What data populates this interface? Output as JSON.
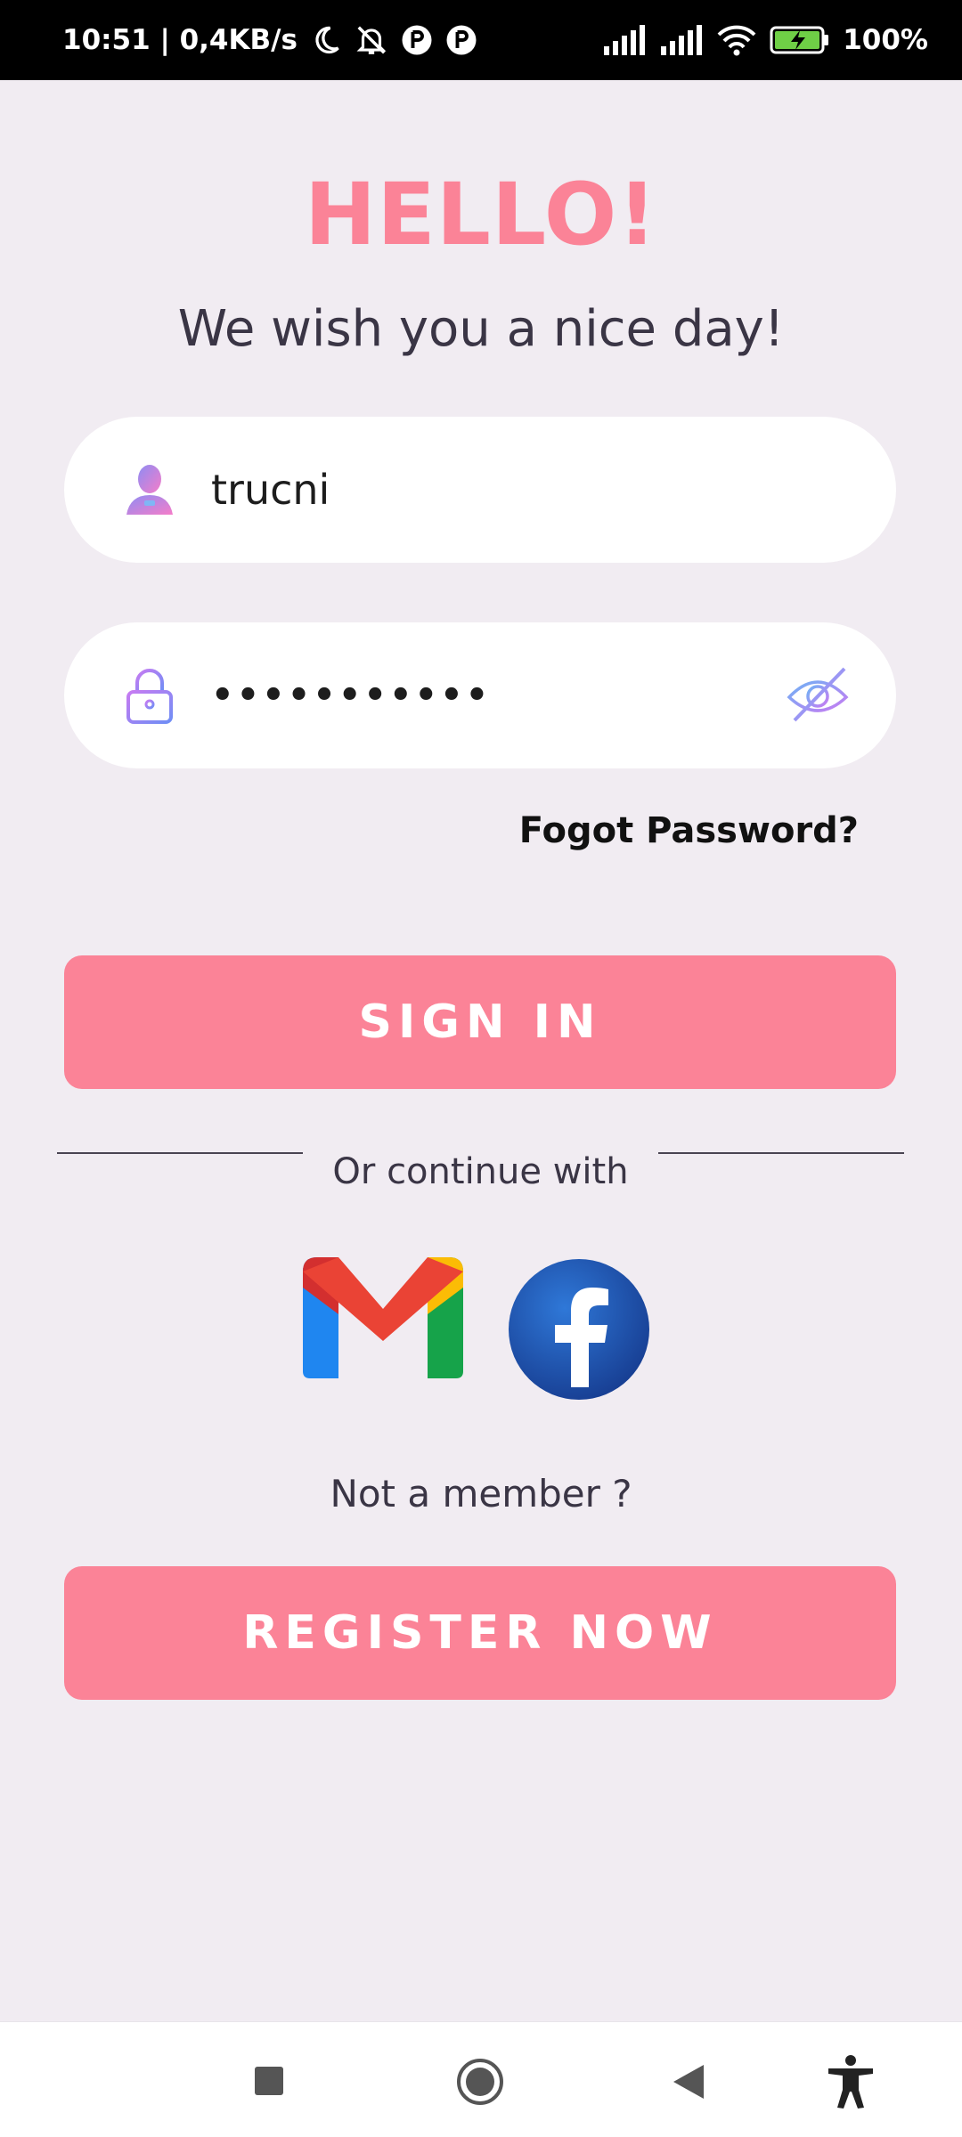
{
  "status_bar": {
    "time_speed": "10:51 | 0,4KB/s",
    "battery_percent": "100%"
  },
  "login": {
    "title": "HELLO!",
    "subtitle": "We wish you a nice day!",
    "username_value": "trucni",
    "password_value": "•••••••••••",
    "forgot_label": "Fogot Password?",
    "signin_label": "SIGN IN",
    "divider_text": "Or continue with",
    "not_member_text": "Not a member ?",
    "register_label": "REGISTER NOW"
  },
  "colors": {
    "accent": "#fb8397",
    "background": "#f1ecf2",
    "text_dark": "#3a3545"
  },
  "icons": {
    "username": "user-icon",
    "password": "lock-icon",
    "visibility": "eye-off-icon",
    "gmail": "gmail-icon",
    "facebook": "facebook-icon",
    "nav": [
      "recents-icon",
      "home-icon",
      "back-icon",
      "accessibility-icon"
    ]
  }
}
